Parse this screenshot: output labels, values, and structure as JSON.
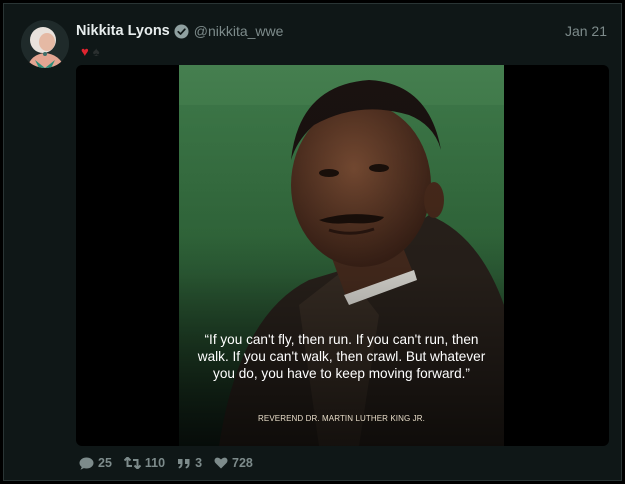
{
  "tweet": {
    "display_name": "Nikkita Lyons",
    "handle": "@nikkita_wwe",
    "date": "Jan 21",
    "emojis": [
      "♥",
      "♠"
    ]
  },
  "media": {
    "quote": "“If you can't fly, then run. If you can't run, then walk. If you can't walk, then crawl. But whatever you do, you have to keep moving forward.”",
    "attribution": "REVEREND DR. MARTIN LUTHER KING JR."
  },
  "actions": {
    "replies": "25",
    "retweets": "110",
    "quotes": "3",
    "likes": "728"
  },
  "colors": {
    "background": "#0f1717",
    "text_primary": "#e8eeee",
    "text_secondary": "#7d8b8b",
    "heart": "#e0242f"
  }
}
